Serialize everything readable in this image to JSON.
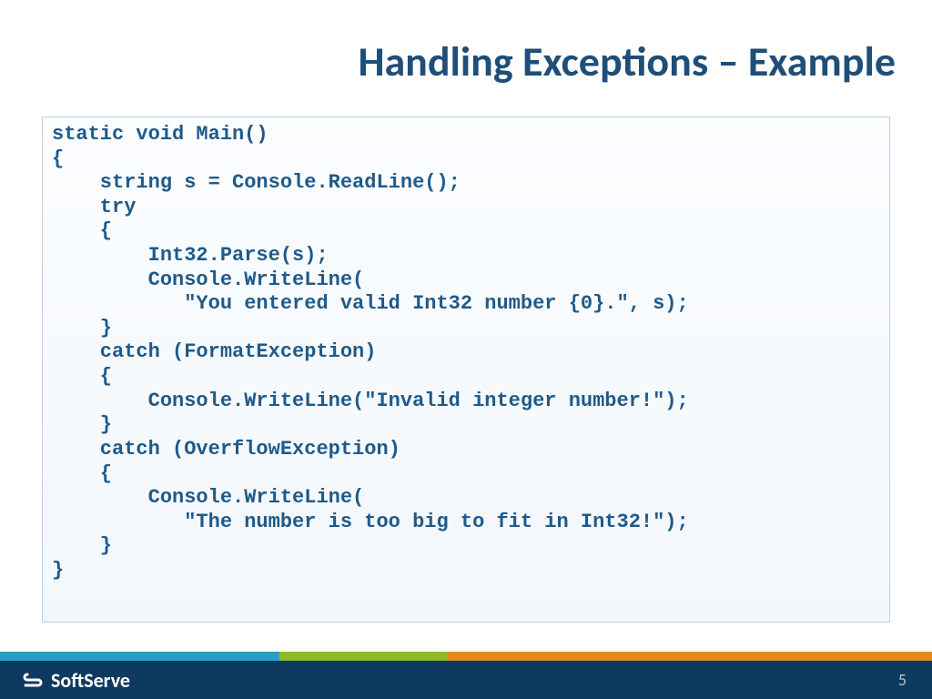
{
  "title": "Handling Exceptions – Example",
  "code": "static void Main()\n{\n    string s = Console.ReadLine();\n    try\n    {\n        Int32.Parse(s);\n        Console.WriteLine(\n           \"You entered valid Int32 number {0}.\", s);\n    }\n    catch (FormatException)\n    {\n        Console.WriteLine(\"Invalid integer number!\");\n    }\n    catch (OverflowException)\n    {\n        Console.WriteLine(\n           \"The number is too big to fit in Int32!\");\n    }\n}",
  "brand": "SoftServe",
  "slide_number": "5"
}
